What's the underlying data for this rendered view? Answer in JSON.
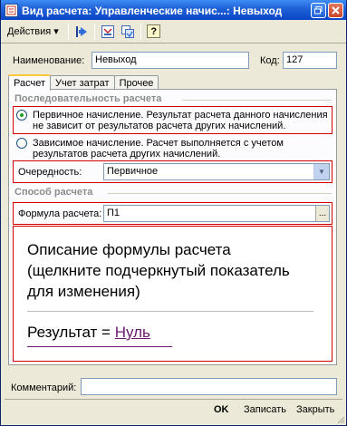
{
  "window": {
    "title": "Вид расчета: Управленческие начис...: Невыход"
  },
  "toolbar": {
    "actions_label": "Действия",
    "actions_arrow": "▾",
    "help_label": "?"
  },
  "fields": {
    "name_label": "Наименование:",
    "name_value": "Невыход",
    "code_label": "Код:",
    "code_value": "127"
  },
  "tabs": [
    "Расчет",
    "Учет затрат",
    "Прочее"
  ],
  "sequence": {
    "title": "Последовательность расчета",
    "primary_text": "Первичное начисление. Результат расчета данного начисления не зависит от результатов расчета других начислений.",
    "dependent_text": "Зависимое начисление. Расчет выполняется с учетом результатов расчета других начислений.",
    "order_label": "Очередность:",
    "order_value": "Первичное"
  },
  "method": {
    "title": "Способ расчета",
    "formula_label": "Формула расчета:",
    "formula_value": "П1",
    "dots_label": "...",
    "description": "Описание формулы расчета (щелкните подчеркнутый показатель для изменения)",
    "result_prefix": "Результат = ",
    "result_link": "Нуль"
  },
  "footer": {
    "comment_label": "Комментарий:",
    "comment_value": "",
    "ok_label": "OK",
    "save_label": "Записать",
    "close_label": "Закрыть"
  }
}
